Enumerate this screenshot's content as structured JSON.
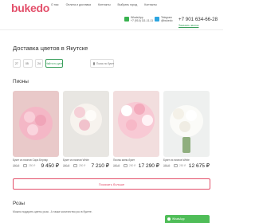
{
  "header": {
    "logo": "bukedo",
    "nav": [
      "О нас",
      "Оплата и доставка",
      "Контакты",
      "Выбрать город",
      "Контакты"
    ],
    "whatsapp": {
      "line1": "WhatsApp",
      "line2": "+7 (914) 111-11-11"
    },
    "telegram": {
      "line1": "Telegram",
      "line2": "@bukedo"
    },
    "phone": "+7 901 634-66-28",
    "callback": "Заказать звонок",
    "colors": {
      "brand": "#e34f6a",
      "accent": "#3a9f5c"
    }
  },
  "page": {
    "title": "Доставка цветов в Якутске"
  },
  "filters": {
    "day": "27",
    "month": "05",
    "year": "24",
    "button": "Найти по дате",
    "search_placeholder": "Поиск по букетам"
  },
  "section": {
    "title": "Пионы"
  },
  "cards": [
    {
      "name": "Букет из пионов Сара Бернар",
      "old_price": "250 ₽",
      "old_price_b": "250 ₽",
      "price": "9 450 ₽"
    },
    {
      "name": "Букет из пионов White",
      "old_price": "250 ₽",
      "old_price_b": "250 ₽",
      "price": "7 210 ₽"
    },
    {
      "name": "Пионы мини-букет",
      "old_price": "250 ₽",
      "old_price_b": "250 ₽",
      "price": "17 290 ₽"
    },
    {
      "name": "Букет из пионов White",
      "old_price": "250 ₽",
      "old_price_b": "250 ₽",
      "price": "12 675 ₽"
    }
  ],
  "more": {
    "label": "Показать больше"
  },
  "roses": {
    "title": "Розы",
    "desc": "Можно подарить цветы роза . А также количество роз в букете."
  },
  "widget": {
    "label": "WhatsApp"
  }
}
